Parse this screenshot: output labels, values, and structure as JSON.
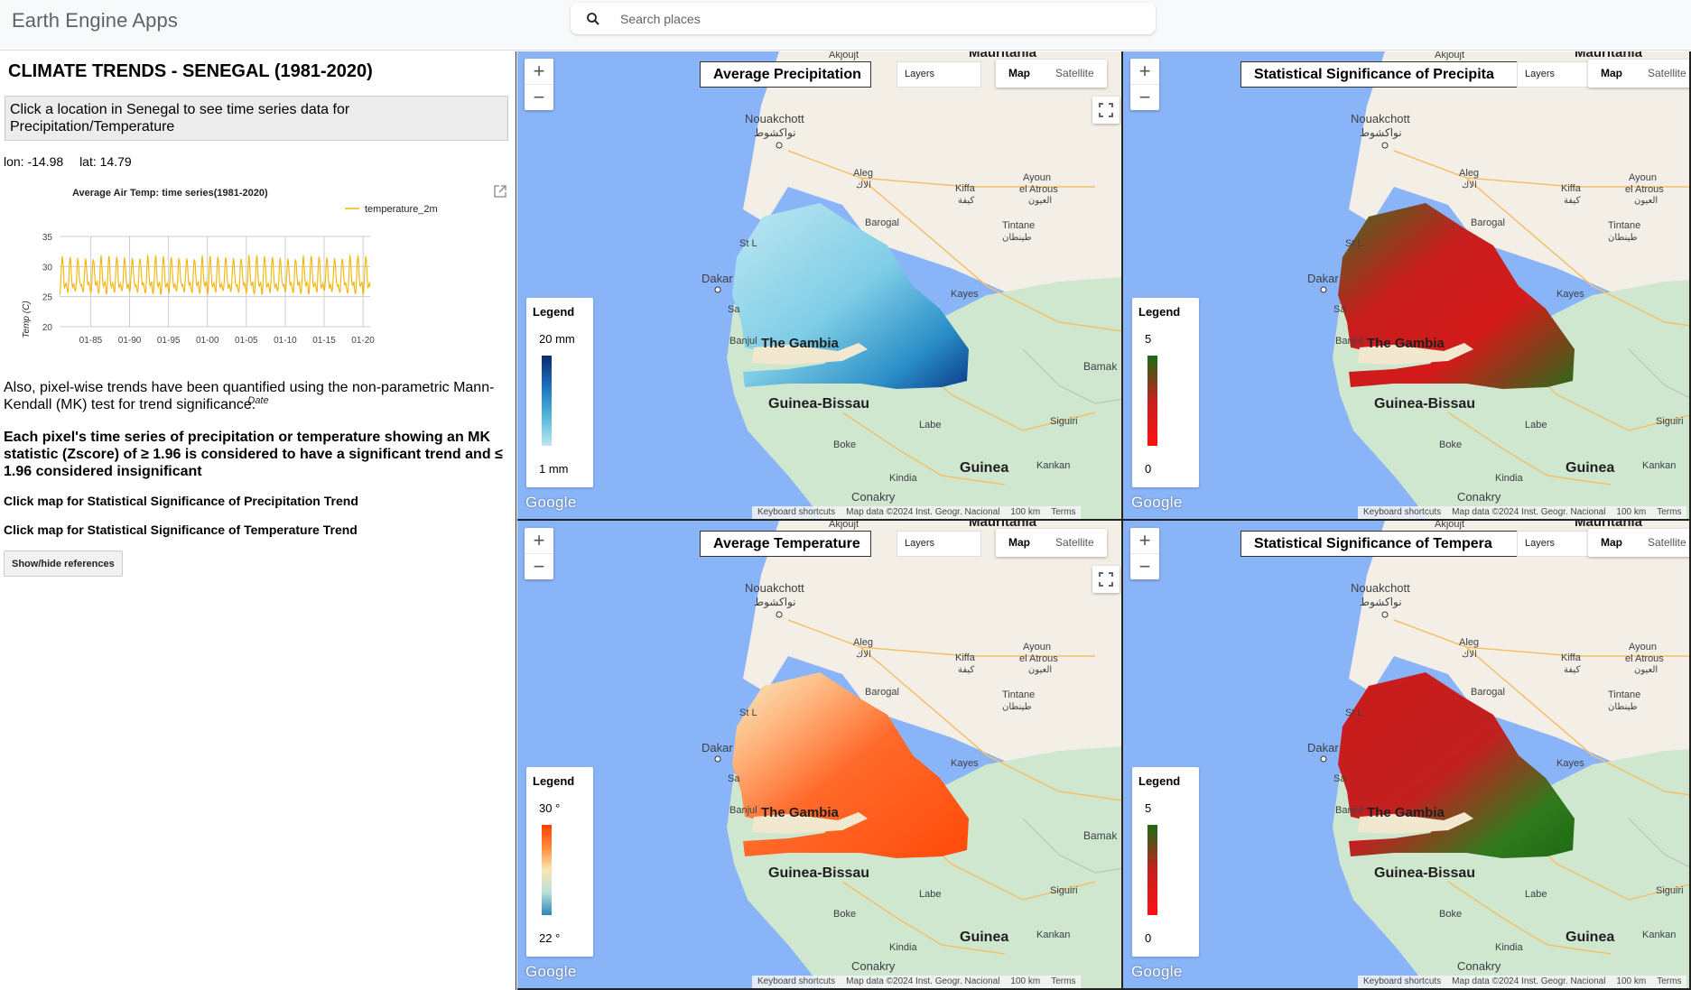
{
  "app": {
    "title": "Earth Engine Apps",
    "search_placeholder": "Search places"
  },
  "panel": {
    "heading": "CLIMATE TRENDS - SENEGAL (1981-2020)",
    "instruction": "Click a location in Senegal to see time series data for Precipitation/Temperature",
    "lon": "lon: -14.98",
    "lat": "lat: 14.79",
    "para1": "Also, pixel-wise trends have been quantified using the non-parametric Mann-Kendall (MK) test for trend significance.",
    "para2": "Each pixel's time series of precipitation or temperature showing an MK statistic (Zscore) of ≥ 1.96 is considered to have a significant trend and ≤ 1.96 considered insignificant",
    "link_precip": "Click map for Statistical Significance of Precipitation Trend",
    "link_temp": "Click map for Statistical Significance of Temperature Trend",
    "references_button": "Show/hide references"
  },
  "chart_data": {
    "type": "line",
    "title": "Average Air Temp: time series(1981-2020)",
    "xlabel": "Date",
    "ylabel": "Temp (C)",
    "ylim": [
      20,
      35
    ],
    "yticks": [
      20,
      25,
      30,
      35
    ],
    "xticks": [
      "01-85",
      "01-90",
      "01-95",
      "01-00",
      "01-05",
      "01-10",
      "01-15",
      "01-20"
    ],
    "legend": "top-right",
    "series": [
      {
        "name": "temperature_2m",
        "color": "#f5b400",
        "description_seasonal": "monthly values oscillating ~24-32 C each year from 1981 to 2020",
        "x_start": "1981-01",
        "x_end": "2020-12",
        "annual_min": 24.5,
        "annual_max": 31.5
      }
    ]
  },
  "maps": [
    {
      "title": "Average Precipitation",
      "legend_title": "Legend",
      "legend_max": "20 mm",
      "legend_min": "1 mm",
      "legend_colors": [
        "#0b2a6f",
        "#1a6fbf",
        "#4fb6d9",
        "#bfe8f2"
      ],
      "overlay": "precip"
    },
    {
      "title": "Statistical Significance of Precipita",
      "legend_title": "Legend",
      "legend_max": "5",
      "legend_min": "0",
      "legend_colors": [
        "#1a6b14",
        "#c62020",
        "#ff1010"
      ],
      "overlay": "sig_precip"
    },
    {
      "title": "Average Temperature",
      "legend_title": "Legend",
      "legend_max": "30 °",
      "legend_min": "22 °",
      "legend_colors": [
        "#ff3f00",
        "#ff8b3a",
        "#fbe7b0",
        "#b9dfd9",
        "#2c86b8"
      ],
      "overlay": "temp"
    },
    {
      "title": "Statistical Significance of Tempera",
      "legend_title": "Legend",
      "legend_max": "5",
      "legend_min": "0",
      "legend_colors": [
        "#1a6b14",
        "#c62020",
        "#ff1010"
      ],
      "overlay": "sig_temp"
    }
  ],
  "map_common": {
    "layers_label": "Layers",
    "map_label": "Map",
    "satellite_label": "Satellite",
    "google": "Google",
    "keyboard": "Keyboard shortcuts",
    "mapdata": "Map data ©2024 Inst. Geogr. Nacional",
    "scale": "100 km",
    "terms": "Terms",
    "place_labels": {
      "akjoujt": "Akjoujt",
      "mauritania": "Mauritania",
      "nouakchott": "Nouakchott",
      "nouakchott_ar": "نواكشوط",
      "aleg": "Aleg",
      "aleg_ar": "الاك",
      "kiffa": "Kiffa",
      "kiffa_ar": "كيفة",
      "ayoun": "Ayoun",
      "ayoun2": "el Atrous",
      "ayoun_ar": "العيون",
      "barogal": "Barogal",
      "tintane": "Tintane",
      "tintane_ar": "طينطان",
      "st_l": "St L",
      "dakar": "Dakar",
      "kayes": "Kayes",
      "banjul": "Banjul",
      "gambia": "The Gambia",
      "bamako": "Bamak",
      "guinea_bissau": "Guinea-Bissau",
      "labe": "Labe",
      "siguiri": "Siguiri",
      "boke": "Boke",
      "guinea": "Guinea",
      "kindia": "Kindia",
      "kankan": "Kankan",
      "conakry": "Conakry",
      "sa": "Sa"
    }
  }
}
